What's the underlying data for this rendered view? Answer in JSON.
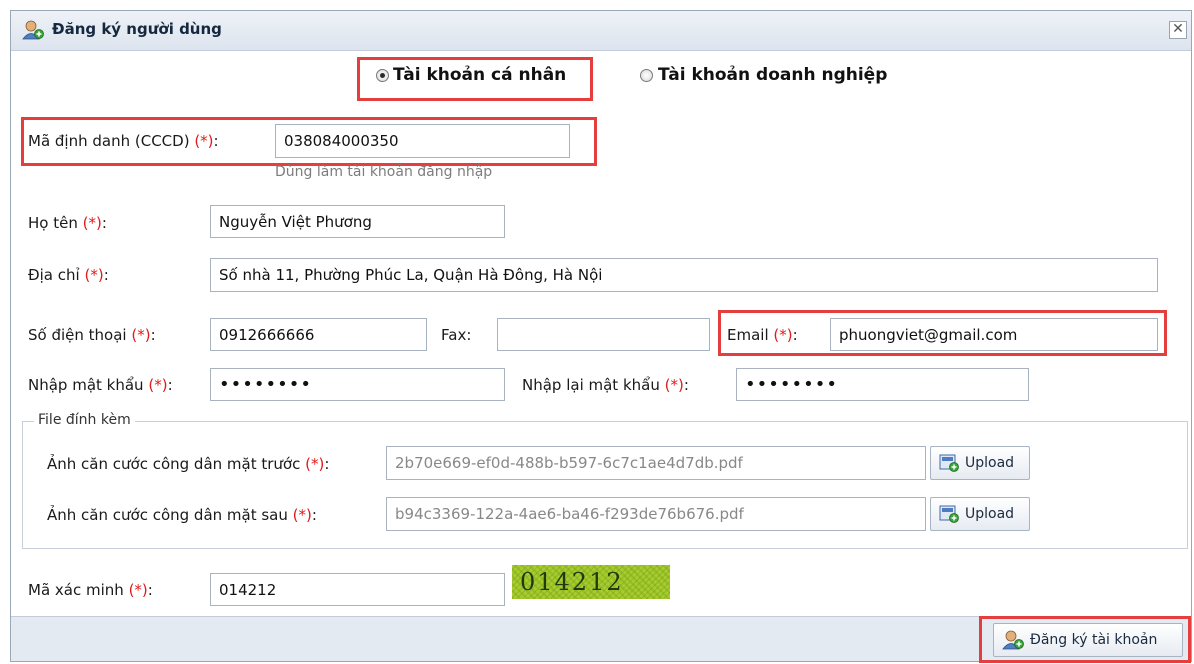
{
  "dialog": {
    "title": "Đăng ký người dùng",
    "close_glyph": "✕"
  },
  "account_type": {
    "personal_label": "Tài khoản cá nhân",
    "business_label": "Tài khoản doanh nghiệp",
    "selected": "personal"
  },
  "form": {
    "required_mark": "(*)",
    "id_number": {
      "label": "Mã định danh (CCCD)",
      "value": "038084000350",
      "hint": "Dùng làm tài khoản đăng nhập"
    },
    "full_name": {
      "label": "Họ tên",
      "value": "Nguyễn Việt Phương"
    },
    "address": {
      "label": "Địa chỉ",
      "value": "Số nhà 11, Phường Phúc La, Quận Hà Đông, Hà Nội"
    },
    "phone": {
      "label": "Số điện thoại",
      "value": "0912666666"
    },
    "fax": {
      "label": "Fax:",
      "value": ""
    },
    "email": {
      "label": "Email",
      "value": "phuongviet@gmail.com"
    },
    "password": {
      "label": "Nhập mật khẩu",
      "value": "••••••••"
    },
    "password_confirm": {
      "label": "Nhập lại mật khẩu",
      "value": "••••••••"
    },
    "attachments": {
      "legend": "File đính kèm",
      "front": {
        "label": "Ảnh căn cước công dân mặt trước",
        "value": "2b70e669-ef0d-488b-b597-6c7c1ae4d7db.pdf",
        "button": "Upload"
      },
      "back": {
        "label": "Ảnh căn cước công dân mặt sau",
        "value": "b94c3369-122a-4ae6-ba46-f293de76b676.pdf",
        "button": "Upload"
      }
    },
    "captcha": {
      "label": "Mã xác minh",
      "value": "014212",
      "image_text": "014212"
    }
  },
  "footer": {
    "submit_label": "Đăng ký tài khoản"
  },
  "colors": {
    "highlight": "#e53e3e",
    "required": "#e01b1b",
    "captcha_bg": "#a6cc2e"
  }
}
